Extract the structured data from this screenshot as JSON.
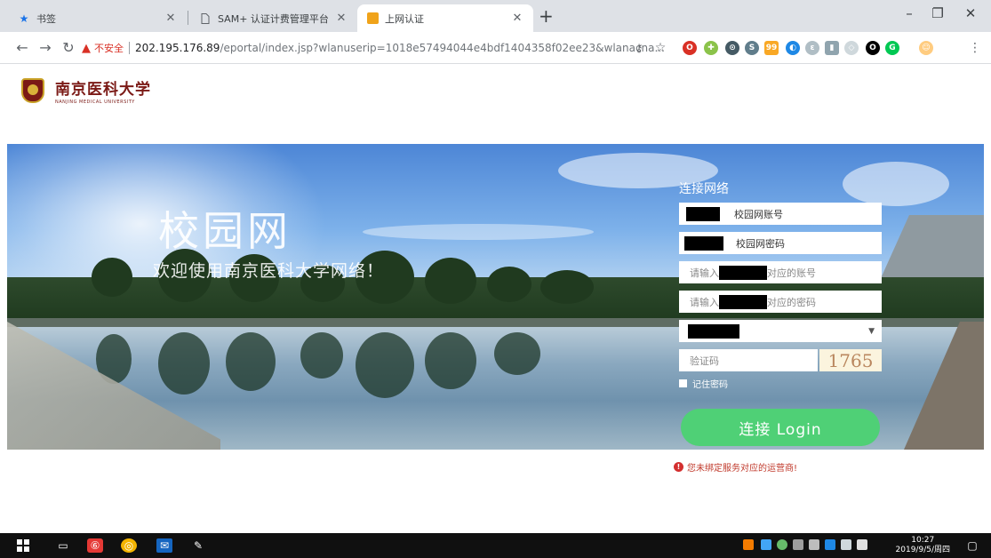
{
  "tabs": [
    {
      "label": "书签",
      "icon": "star-icon"
    },
    {
      "label": "SAM+ 认证计费管理平台",
      "icon": "page-icon"
    },
    {
      "label": "上网认证",
      "icon": "portal-favicon-icon",
      "active": true
    }
  ],
  "address": {
    "insecure_label": "不安全",
    "url_host": "202.195.176.89",
    "url_path": "/eportal/index.jsp?wlanuserip=1018e57494044e4bdf1404358f02ee23&wlanacna..."
  },
  "logo": {
    "name_cn": "南京医科大学",
    "name_en": "NANJING MEDICAL UNIVERSITY"
  },
  "banner": {
    "title": "校园网",
    "subtitle": "欢迎使用南京医科大学网络！"
  },
  "login": {
    "title": "连接网络",
    "account_label": "校园网账号",
    "password_label": "校园网密码",
    "sub_account_prefix": "请输入",
    "sub_account_suffix": "对应的账号",
    "sub_password_prefix": "请输入",
    "sub_password_suffix": "对应的密码",
    "captcha_placeholder": "验证码",
    "captcha_code": "1765",
    "remember_label": "记住密码",
    "button_label": "连接 Login",
    "error_text": "您未绑定服务对应的运营商!"
  },
  "taskbar": {
    "time": "10:27",
    "date": "2019/9/5/周四"
  },
  "colors": {
    "login_button": "#4fd076",
    "error": "#d32f2f",
    "brand": "#7b1a16"
  }
}
